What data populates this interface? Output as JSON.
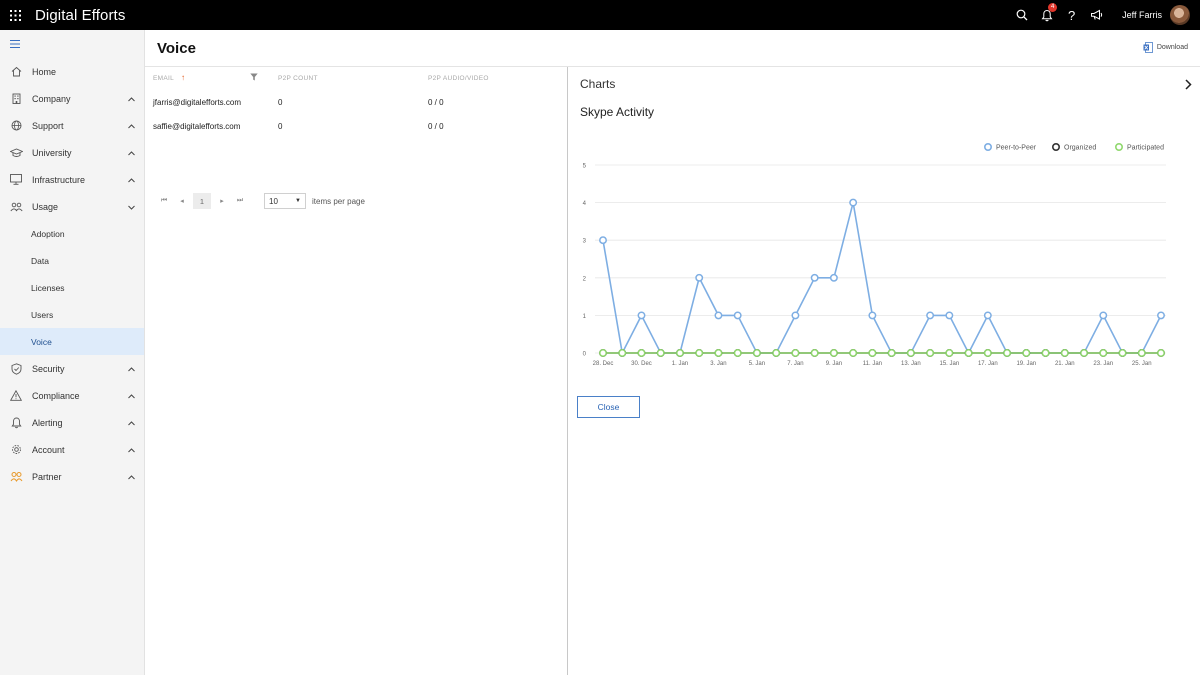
{
  "topbar": {
    "app_title": "Digital Efforts",
    "notification_count": "4",
    "user_name": "Jeff Farris"
  },
  "sidebar": {
    "items": [
      {
        "label": "Home",
        "icon": "home-icon"
      },
      {
        "label": "Company",
        "icon": "building-icon"
      },
      {
        "label": "Support",
        "icon": "globe-icon"
      },
      {
        "label": "University",
        "icon": "graduation-cap-icon"
      },
      {
        "label": "Infrastructure",
        "icon": "monitor-icon"
      },
      {
        "label": "Usage",
        "icon": "people-icon"
      },
      {
        "label": "Security",
        "icon": "shield-icon"
      },
      {
        "label": "Compliance",
        "icon": "warning-icon"
      },
      {
        "label": "Alerting",
        "icon": "bell-icon"
      },
      {
        "label": "Account",
        "icon": "gear-icon"
      },
      {
        "label": "Partner",
        "icon": "partner-icon"
      }
    ],
    "usage_subitems": [
      "Adoption",
      "Data",
      "Licenses",
      "Users",
      "Voice"
    ],
    "active_subitem": "Voice"
  },
  "main": {
    "page_title": "Voice",
    "download_label": "Download"
  },
  "table": {
    "columns": [
      "EMAIL",
      "P2P COUNT",
      "P2P AUDIO/VIDEO"
    ],
    "rows": [
      [
        "jfarris@digitalefforts.com",
        "0",
        "0 / 0"
      ],
      [
        "saffie@digitalefforts.com",
        "0",
        "0 / 0"
      ]
    ],
    "pager": {
      "current_page": "1",
      "per_page": "10",
      "per_page_label": "items per page"
    }
  },
  "panel": {
    "title": "Charts",
    "close_label": "Close"
  },
  "chart_data": {
    "type": "line",
    "title": "Skype Activity",
    "ylim": [
      0,
      5
    ],
    "yticks": [
      "0",
      "1",
      "2",
      "3",
      "4",
      "5"
    ],
    "x": [
      "28. Dec",
      "29. Dec",
      "30. Dec",
      "31. Dec",
      "1. Jan",
      "2. Jan",
      "3. Jan",
      "4. Jan",
      "5. Jan",
      "6. Jan",
      "7. Jan",
      "8. Jan",
      "9. Jan",
      "10. Jan",
      "11. Jan",
      "12. Jan",
      "13. Jan",
      "14. Jan",
      "15. Jan",
      "16. Jan",
      "17. Jan",
      "18. Jan",
      "19. Jan",
      "20. Jan",
      "21. Jan",
      "22. Jan",
      "23. Jan",
      "24. Jan",
      "25. Jan",
      "26. Jan"
    ],
    "xtick_labels": [
      "28. Dec",
      "30. Dec",
      "1. Jan",
      "3. Jan",
      "5. Jan",
      "7. Jan",
      "9. Jan",
      "11. Jan",
      "13. Jan",
      "15. Jan",
      "17. Jan",
      "19. Jan",
      "21. Jan",
      "23. Jan",
      "25. Jan"
    ],
    "grid": true,
    "legend": "top-right",
    "series": [
      {
        "name": "Peer-to-Peer",
        "color": "#7eaee3",
        "values": [
          3,
          0,
          1,
          0,
          0,
          2,
          1,
          1,
          0,
          0,
          1,
          2,
          2,
          4,
          1,
          0,
          0,
          1,
          1,
          0,
          1,
          0,
          0,
          0,
          0,
          0,
          1,
          0,
          0,
          1
        ]
      },
      {
        "name": "Organized",
        "color": "#333333",
        "values": [
          0,
          0,
          0,
          0,
          0,
          0,
          0,
          0,
          0,
          0,
          0,
          0,
          0,
          0,
          0,
          0,
          0,
          0,
          0,
          0,
          0,
          0,
          0,
          0,
          0,
          0,
          0,
          0,
          0,
          0
        ]
      },
      {
        "name": "Participated",
        "color": "#90d86e",
        "values": [
          0,
          0,
          0,
          0,
          0,
          0,
          0,
          0,
          0,
          0,
          0,
          0,
          0,
          0,
          0,
          0,
          0,
          0,
          0,
          0,
          0,
          0,
          0,
          0,
          0,
          0,
          0,
          0,
          0,
          0
        ]
      }
    ]
  }
}
